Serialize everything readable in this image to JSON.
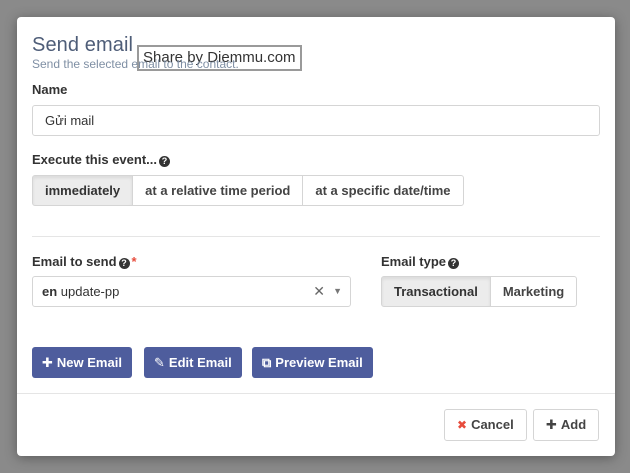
{
  "modal": {
    "title": "Send email",
    "watermark": "Share by Diemmu.com",
    "subtitle": "Send the selected email to the contact."
  },
  "name_field": {
    "label": "Name",
    "value": "Gửi mail"
  },
  "execute": {
    "label": "Execute this event...",
    "options": [
      "immediately",
      "at a relative time period",
      "at a specific date/time"
    ],
    "selected": "immediately"
  },
  "email_to_send": {
    "label": "Email to send",
    "required_mark": "*",
    "lang_prefix": "en",
    "value": "update-pp"
  },
  "email_type": {
    "label": "Email type",
    "options": [
      "Transactional",
      "Marketing"
    ],
    "selected": "Transactional"
  },
  "actions": {
    "new_email": "New Email",
    "edit_email": "Edit Email",
    "preview_email": "Preview Email"
  },
  "footer": {
    "cancel": "Cancel",
    "add": "Add"
  },
  "colors": {
    "primary": "#4e5d9d",
    "title": "#4e5d78",
    "danger": "#e74c3c"
  }
}
